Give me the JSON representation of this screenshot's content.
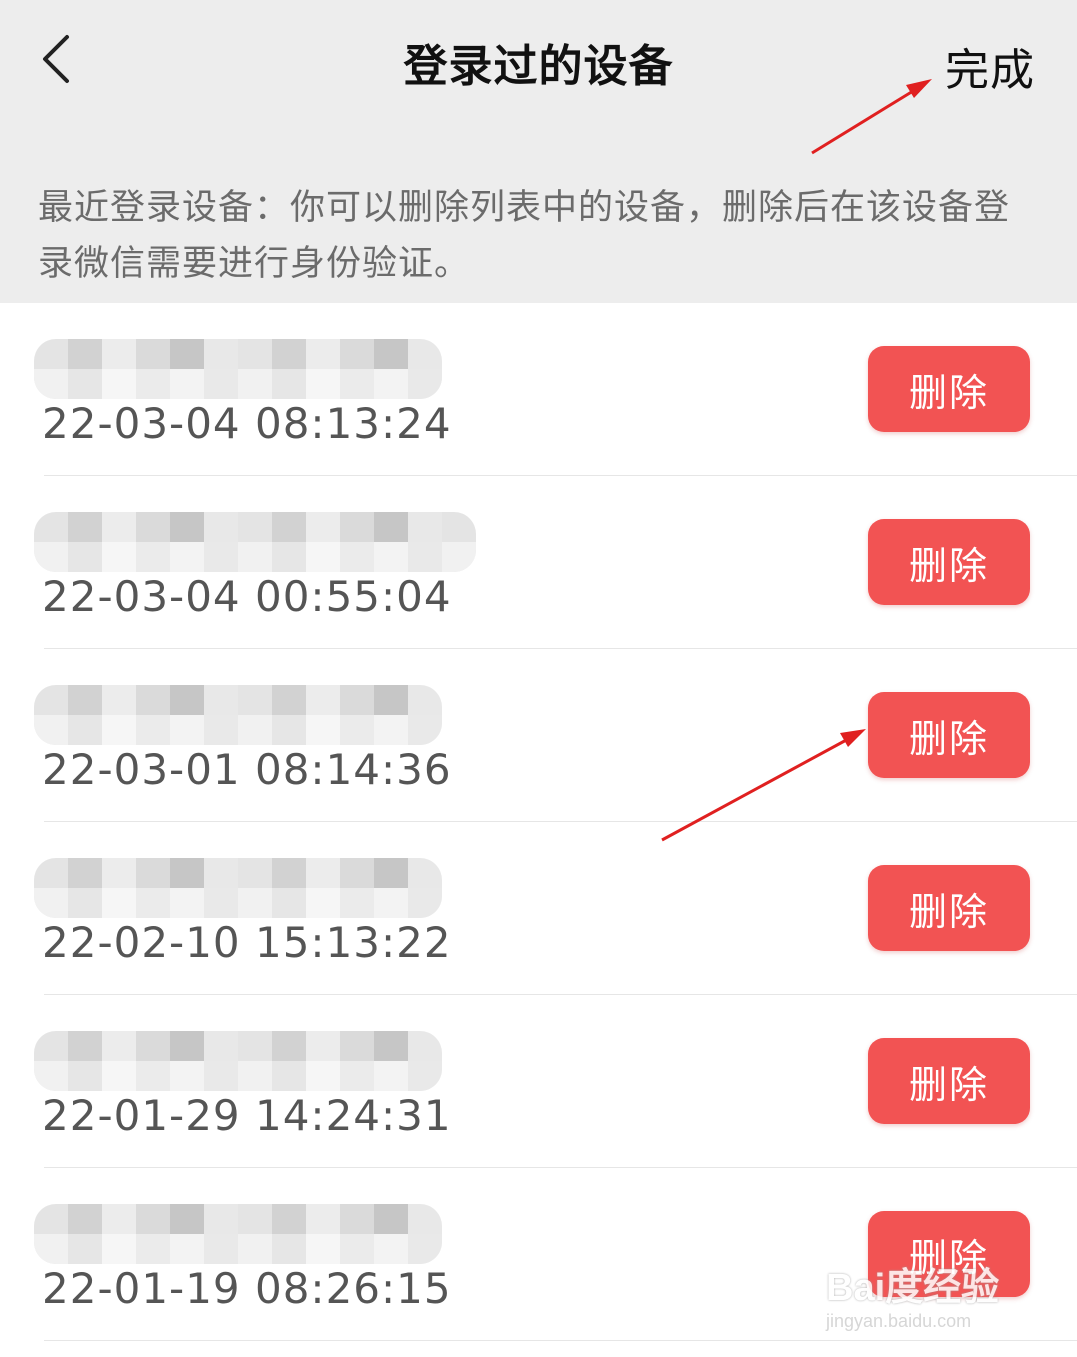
{
  "header": {
    "back_icon": "chevron-left-icon",
    "title": "登录过的设备",
    "done_label": "完成",
    "description": "最近登录设备：你可以删除列表中的设备，删除后在该设备登录微信需要进行身份验证。"
  },
  "devices": [
    {
      "name_blurred": true,
      "time": "22-03-04 08:13:24",
      "delete_label": "删除"
    },
    {
      "name_blurred": true,
      "time": "22-03-04 00:55:04",
      "delete_label": "删除"
    },
    {
      "name_blurred": true,
      "time": "22-03-01 08:14:36",
      "delete_label": "删除"
    },
    {
      "name_blurred": true,
      "time": "22-02-10 15:13:22",
      "delete_label": "删除"
    },
    {
      "name_blurred": true,
      "time": "22-01-29 14:24:31",
      "delete_label": "删除"
    },
    {
      "name_blurred": true,
      "time": "22-01-19 08:26:15",
      "delete_label": "删除"
    }
  ],
  "colors": {
    "header_bg": "#ededed",
    "delete_button": "#f25353",
    "annotation_arrow": "#e02020"
  },
  "watermark": {
    "main": "Bai度经验",
    "sub": "jingyan.baidu.com"
  }
}
